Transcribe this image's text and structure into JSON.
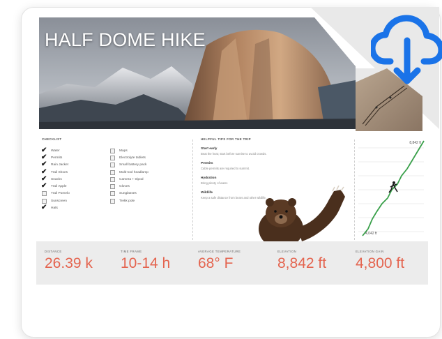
{
  "title": "HALF DOME HIKE",
  "checklist": {
    "header": "CHECKLIST",
    "columns": [
      [
        {
          "label": "Water",
          "checked": true
        },
        {
          "label": "Permits",
          "checked": true
        },
        {
          "label": "Rain Jacket",
          "checked": true
        },
        {
          "label": "Trail Shoes",
          "checked": true
        },
        {
          "label": "Snacks",
          "checked": true
        },
        {
          "label": "Trail Apple",
          "checked": true
        },
        {
          "label": "Trail Pomelo",
          "checked": false
        },
        {
          "label": "Sunscreen",
          "checked": false
        },
        {
          "label": "Hats",
          "checked": true
        }
      ],
      [
        {
          "label": "Maps",
          "checked": false
        },
        {
          "label": "Electrolyte tablets",
          "checked": false
        },
        {
          "label": "Small battery pack",
          "checked": false
        },
        {
          "label": "Multi-tool headlamp",
          "checked": false
        },
        {
          "label": "Camera + tripod",
          "checked": false
        },
        {
          "label": "Gloves",
          "checked": false
        },
        {
          "label": "Sunglasses",
          "checked": false
        },
        {
          "label": "Trekk pole",
          "checked": false
        }
      ]
    ]
  },
  "tips": {
    "header": "HELPFUL TIPS FOR THE TRIP",
    "items": [
      {
        "title": "Start early",
        "desc": "Beat the heat; start before sunrise to avoid crowds."
      },
      {
        "title": "Permits",
        "desc": "Cable permits are required to summit."
      },
      {
        "title": "Hydration",
        "desc": "Bring plenty of water."
      },
      {
        "title": "Wildlife",
        "desc": "Keep a safe distance from bears and other wildlife."
      }
    ]
  },
  "elevation": {
    "top_label": "8,842 ft",
    "bottom_label": "4,042 ft"
  },
  "stats": [
    {
      "label": "Distance",
      "value": "26.39 k"
    },
    {
      "label": "Time Frame",
      "value": "10-14 h"
    },
    {
      "label": "Average Temperature",
      "value": "68° F"
    },
    {
      "label": "Elevation",
      "value": "8,842 ft"
    },
    {
      "label": "Elevation Gain",
      "value": "4,800 ft"
    }
  ],
  "colors": {
    "accent": "#e4644f",
    "cloud_icon": "#1a73e8",
    "trail_line": "#39a04a"
  },
  "icons": {
    "download": "cloud-download-icon",
    "check": "checkmark-icon",
    "hiker": "hiker-icon",
    "bear": "bear-image"
  }
}
